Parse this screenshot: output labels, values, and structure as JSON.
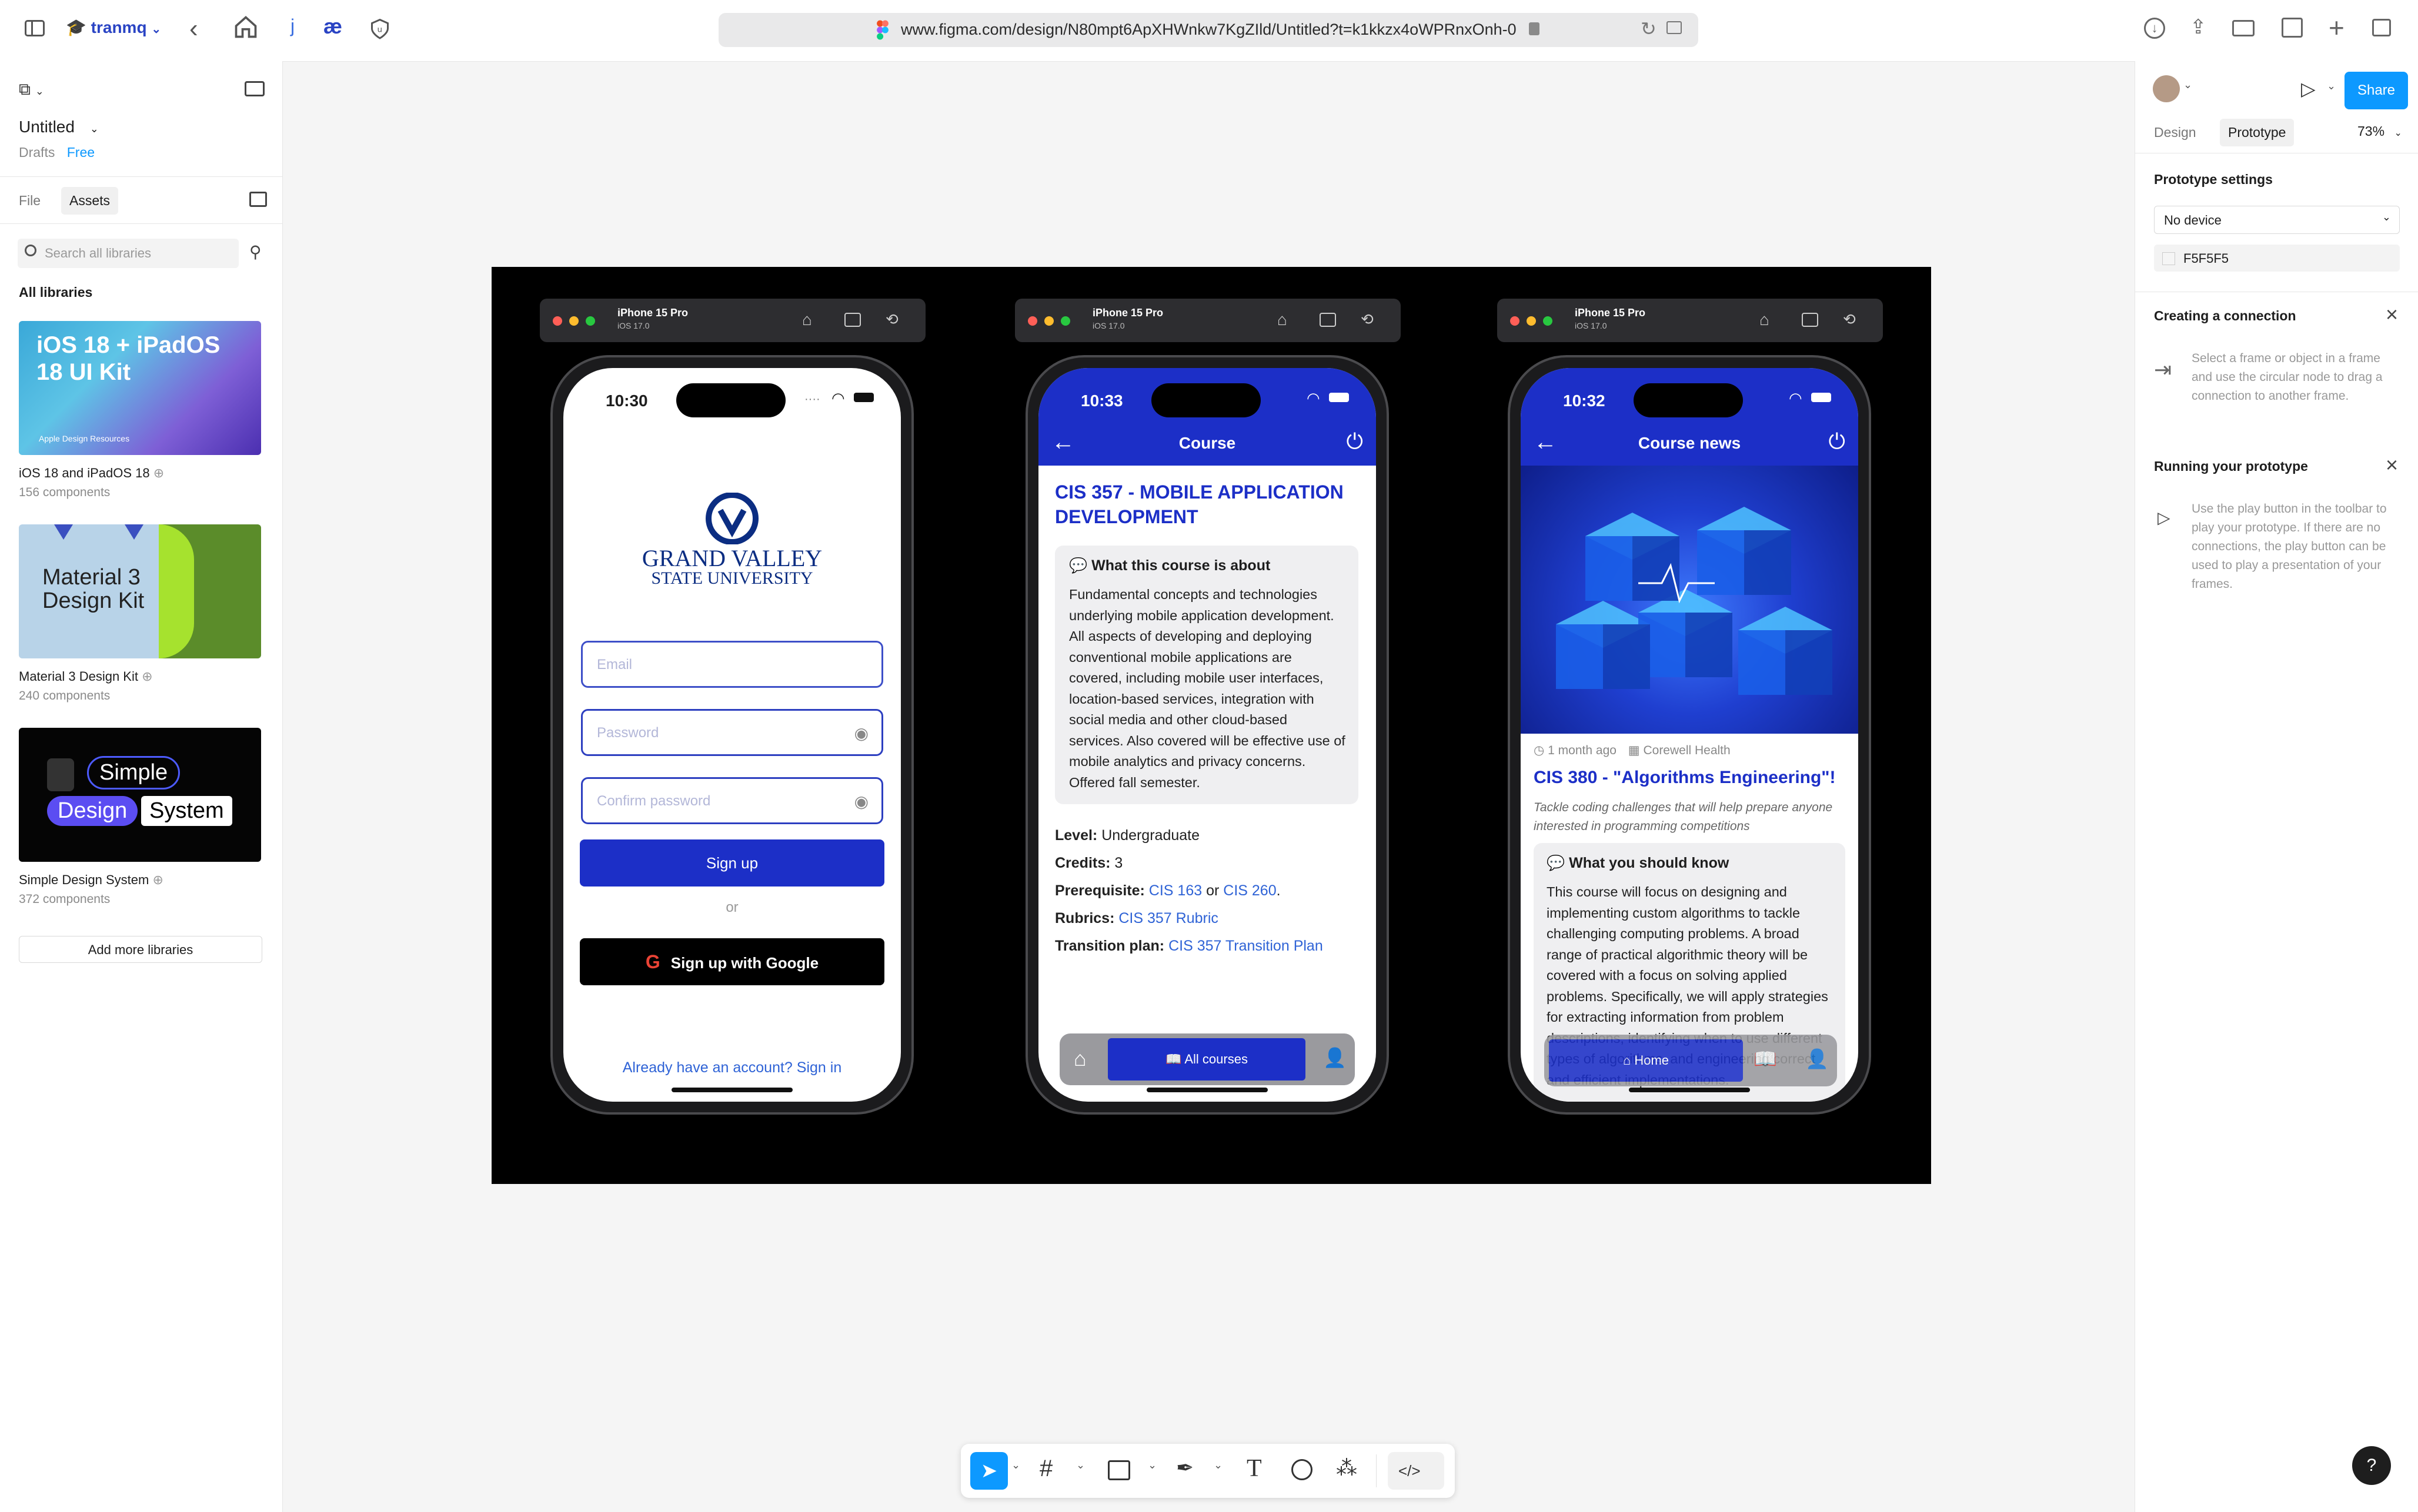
{
  "browser": {
    "user": "tranmq",
    "url": "www.figma.com/design/N80mpt6ApXHWnkw7KgZIld/Untitled?t=k1kkzx4oWPRnxOnh-0",
    "ext1": "j",
    "ext2": "æ"
  },
  "left_panel": {
    "file_title": "Untitled",
    "location": "Drafts",
    "plan": "Free",
    "tabs": [
      "File",
      "Assets"
    ],
    "search_placeholder": "Search all libraries",
    "section_title": "All libraries",
    "libraries": [
      {
        "name": "iOS 18 and iPadOS 18",
        "count": "156 components",
        "thumb_title": "iOS 18 + iPadOS 18 UI Kit",
        "thumb_sub": "Apple Design Resources"
      },
      {
        "name": "Material 3 Design Kit",
        "count": "240 components",
        "thumb_title": "Material 3 Design Kit"
      },
      {
        "name": "Simple Design System",
        "count": "372 components",
        "thumb_words": [
          "Simple",
          "Design",
          "System"
        ]
      }
    ],
    "add_button": "Add more libraries"
  },
  "right_panel": {
    "tabs": [
      "Design",
      "Prototype"
    ],
    "zoom": "73%",
    "share": "Share",
    "settings_title": "Prototype settings",
    "device": "No device",
    "bg_color": "F5F5F5",
    "connection_title": "Creating a connection",
    "connection_text": "Select a frame or object in a frame and use the circular node to drag a connection to another frame.",
    "running_title": "Running your prototype",
    "running_text": "Use the play button in the toolbar to play your prototype. If there are no connections, the play button can be used to play a presentation of your frames."
  },
  "phones": [
    {
      "sim_name": "iPhone 15 Pro",
      "sim_os": "iOS 17.0",
      "time": "10:30",
      "logo_line1": "GRAND VALLEY",
      "logo_line2": "STATE UNIVERSITY",
      "email_placeholder": "Email",
      "password_placeholder": "Password",
      "confirm_placeholder": "Confirm password",
      "signup": "Sign up",
      "or": "or",
      "google": "Sign up with Google",
      "signin_link": "Already have an account? Sign in"
    },
    {
      "sim_name": "iPhone 15 Pro",
      "sim_os": "iOS 17.0",
      "time": "10:33",
      "appbar_title": "Course",
      "course_title": "CIS 357 - MOBILE APPLICATION DEVELOPMENT",
      "about_title": "What this course is about",
      "about_text": "Fundamental concepts and technologies underlying mobile application development. All aspects of developing and deploying conventional mobile applications are covered, including mobile user interfaces, location-based services, integration with social media and other cloud-based services. Also covered will be effective use of mobile analytics and privacy concerns. Offered fall semester.",
      "level_label": "Level:",
      "level_value": "Undergraduate",
      "credits_label": "Credits:",
      "credits_value": "3",
      "prereq_label": "Prerequisite:",
      "prereq_a": "CIS 163",
      "prereq_or": "or",
      "prereq_b": "CIS 260",
      "prereq_end": ".",
      "rubrics_label": "Rubrics:",
      "rubrics_value": "CIS 357 Rubric",
      "transition_label": "Transition plan:",
      "transition_value": "CIS 357 Transition Plan",
      "nav_active": "All courses"
    },
    {
      "sim_name": "iPhone 15 Pro",
      "sim_os": "iOS 17.0",
      "time": "10:32",
      "appbar_title": "Course news",
      "meta_time": "1 month ago",
      "meta_org": "Corewell Health",
      "news_title": "CIS 380 - \"Algorithms Engineering\"!",
      "news_sub": "Tackle coding challenges that will help prepare anyone interested in programming competitions",
      "know_title": "What you should know",
      "know_text": "This course will focus on designing and implementing custom algorithms to tackle challenging computing problems. A broad range of practical algorithmic theory will be covered with a focus on solving applied problems. Specifically, we will apply strategies for extracting information from problem descriptions, identifying when to use different types of algorithms, and engineering correct and efficient implementations.",
      "nav_active": "Home"
    }
  ],
  "help": "?",
  "colors": {
    "accent": "#1c2fc7",
    "figma_blue": "#0d99ff",
    "link": "#2f63d6"
  }
}
